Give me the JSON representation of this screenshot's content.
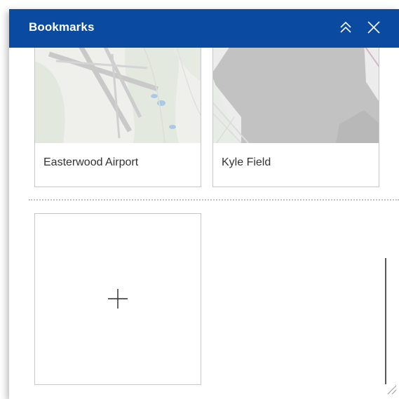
{
  "header": {
    "title": "Bookmarks",
    "collapse_icon": "double-chevron-up-icon",
    "close_icon": "close-icon",
    "background": "#0a4aa0"
  },
  "bookmarks": [
    {
      "label": "Easterwood Airport"
    },
    {
      "label": "Kyle Field"
    }
  ],
  "add_bookmark": {
    "icon": "plus-icon"
  }
}
